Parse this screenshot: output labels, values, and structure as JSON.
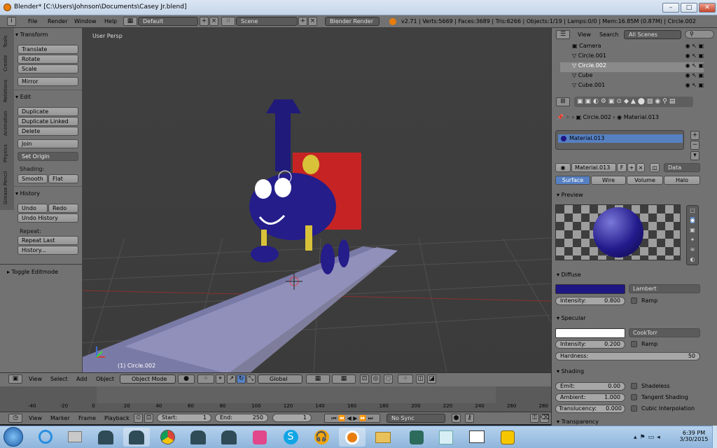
{
  "window": {
    "title": "Blender* [C:\\Users\\Johnson\\Documents\\Casey Jr.blend]",
    "min": "–",
    "max": "□",
    "close": "✕"
  },
  "infobar": {
    "menus": [
      "File",
      "Render",
      "Window",
      "Help"
    ],
    "layout": "Default",
    "scene": "Scene",
    "engine": "Blender Render",
    "stats": "v2.71 | Verts:5669 | Faces:3689 | Tris:6266 | Objects:1/19 | Lamps:0/0 | Mem:16.85M (0.87M) | Circle.002"
  },
  "toolshelf": {
    "tabs": [
      "Tools",
      "Create",
      "Relations",
      "Animation",
      "Physics",
      "Grease Pencil"
    ],
    "transform": {
      "header": "Transform",
      "buttons": [
        "Translate",
        "Rotate",
        "Scale",
        "Mirror"
      ]
    },
    "edit": {
      "header": "Edit",
      "buttons": [
        "Duplicate",
        "Duplicate Linked",
        "Delete",
        "Join"
      ],
      "set_origin": "Set Origin",
      "shading_label": "Shading:",
      "smooth": "Smooth",
      "flat": "Flat"
    },
    "history": {
      "header": "History",
      "undo": "Undo",
      "redo": "Redo",
      "undo_history": "Undo History",
      "repeat_label": "Repeat:",
      "repeat_last": "Repeat Last",
      "history": "History..."
    },
    "toggle": "Toggle Editmode"
  },
  "viewport": {
    "label": "User Persp",
    "object_label": "(1) Circle.002",
    "header": {
      "menus": [
        "View",
        "Select",
        "Add",
        "Object"
      ],
      "mode": "Object Mode",
      "orientation": "Global"
    }
  },
  "timeline": {
    "ticks": [
      "-40",
      "-20",
      "0",
      "20",
      "40",
      "60",
      "80",
      "100",
      "120",
      "140",
      "160",
      "180",
      "200",
      "220",
      "240",
      "260",
      "280"
    ],
    "menus": [
      "View",
      "Marker",
      "Frame",
      "Playback"
    ],
    "start": "Start:",
    "start_val": "1",
    "end": "End:",
    "end_val": "250",
    "current": "1",
    "sync": "No Sync"
  },
  "outliner": {
    "menus": [
      "View",
      "Search"
    ],
    "scenes": "All Scenes",
    "items": [
      "Camera",
      "Circle.001",
      "Circle.002",
      "Cube",
      "Cube.001"
    ]
  },
  "properties": {
    "breadcrumb": [
      "Circle.002",
      "Material.013"
    ],
    "slot": "Material.013",
    "material_name": "Material.013",
    "f": "F",
    "data": "Data",
    "tabs": [
      "Surface",
      "Wire",
      "Volume",
      "Halo"
    ],
    "preview": "Preview",
    "diffuse": {
      "header": "Diffuse",
      "shader": "Lambert",
      "intensity_label": "Intensity:",
      "intensity": "0.800",
      "ramp": "Ramp",
      "color": "#1e1682"
    },
    "specular": {
      "header": "Specular",
      "shader": "CookTorr",
      "intensity_label": "Intensity:",
      "intensity": "0.200",
      "ramp": "Ramp",
      "hardness_label": "Hardness:",
      "hardness": "50",
      "color": "#ffffff"
    },
    "shading": {
      "header": "Shading",
      "emit_label": "Emit:",
      "emit": "0.00",
      "ambient_label": "Ambient:",
      "ambient": "1.000",
      "translucency_label": "Translucency:",
      "translucency": "0.000",
      "shadeless": "Shadeless",
      "tangent": "Tangent Shading",
      "cubic": "Cubic Interpolation"
    },
    "transparency": "Transparency"
  },
  "taskbar": {
    "time": "6:39 PM",
    "date": "3/30/2015"
  }
}
